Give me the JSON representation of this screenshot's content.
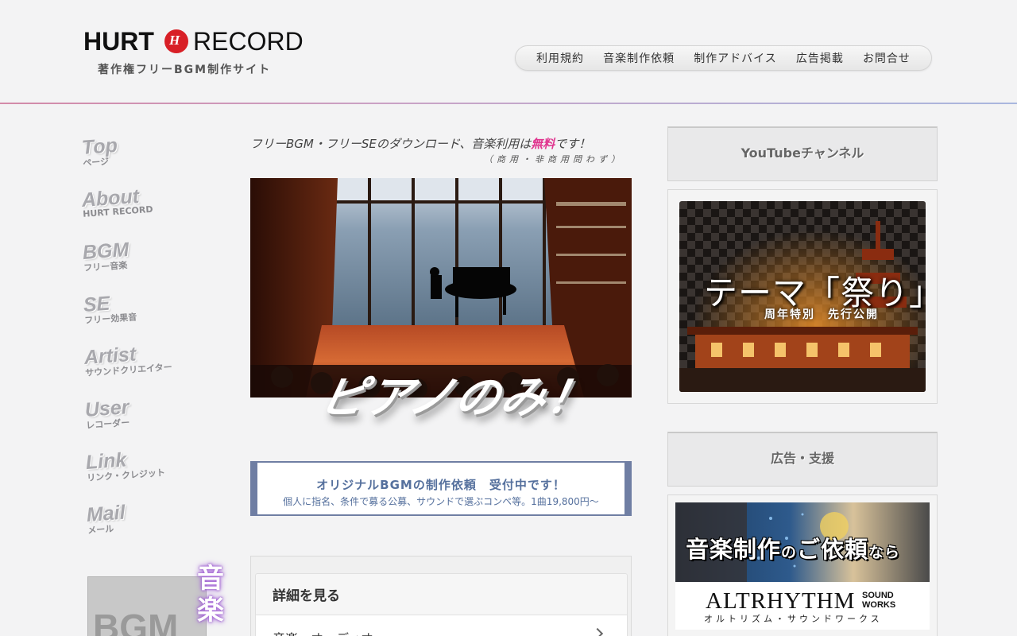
{
  "brand": {
    "name_left": "HURT",
    "mark": "H",
    "name_right": "RECORD",
    "tagline": "著作権フリーBGM制作サイト",
    "mark_color": "#d81f26"
  },
  "topnav": [
    "利用規約",
    "音楽制作依頼",
    "制作アドバイス",
    "広告掲載",
    "お問合せ"
  ],
  "sidenav": [
    {
      "en": "Top",
      "jp": "ページ"
    },
    {
      "en": "About",
      "jp": "HURT RECORD"
    },
    {
      "en": "BGM",
      "jp": "フリー音楽"
    },
    {
      "en": "SE",
      "jp": "フリー効果音"
    },
    {
      "en": "Artist",
      "jp": "サウンドクリエイター"
    },
    {
      "en": "User",
      "jp": "レコーダー"
    },
    {
      "en": "Link",
      "jp": "リンク・クレジット"
    },
    {
      "en": "Mail",
      "jp": "メール"
    }
  ],
  "promo": {
    "bgm_label": "BGM",
    "ongaku_label": "音楽"
  },
  "main": {
    "lead_prefix": "フリーBGM・フリーSEのダウンロード、音楽利用は",
    "lead_highlight": "無料",
    "lead_suffix": "です！",
    "lead_sub": "（商用・非商用問わず）",
    "hero_caption": "ピアノのみ！",
    "request_title": "オリジナルBGMの制作依頼　受付中です！",
    "request_desc": "個人に指名、条件で募る公募、サウンドで選ぶコンペ等。1曲19,800円〜",
    "details_title": "詳細を見る",
    "details_row": "音楽・オーディオ"
  },
  "sidebar": {
    "youtube_title": "YouTubeチャンネル",
    "matsuri_title": "テーマ「祭り」",
    "matsuri_sub": "周年特別　先行公開",
    "ads_title": "広告・支援",
    "ad_headline_a": "音楽制作",
    "ad_headline_b": "の",
    "ad_headline_c": "ご依頼",
    "ad_headline_d": "なら",
    "ad_brand": "ALTRHYTHM",
    "ad_brand_side_1": "SOUND",
    "ad_brand_side_2": "WORKS",
    "ad_kana": "オルトリズム・サウンドワークス"
  },
  "colors": {
    "accent_pink": "#e0368f",
    "request_blue": "#55709d"
  }
}
